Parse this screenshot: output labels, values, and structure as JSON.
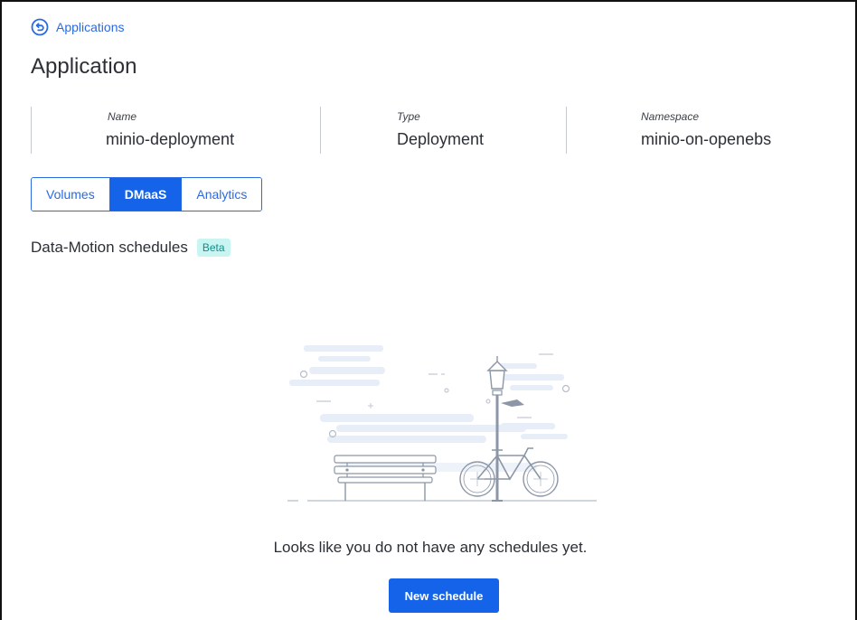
{
  "back_link": {
    "label": "Applications",
    "icon": "back-circle-icon"
  },
  "page": {
    "title": "Application"
  },
  "meta": {
    "name_label": "Name",
    "name_value": "minio-deployment",
    "type_label": "Type",
    "type_value": "Deployment",
    "namespace_label": "Namespace",
    "namespace_value": "minio-on-openebs"
  },
  "tabs": [
    {
      "label": "Volumes",
      "active": false
    },
    {
      "label": "DMaaS",
      "active": true
    },
    {
      "label": "Analytics",
      "active": false
    }
  ],
  "section": {
    "title": "Data-Motion schedules",
    "badge": "Beta"
  },
  "empty_state": {
    "message": "Looks like you do not have any schedules yet.",
    "button_label": "New schedule",
    "illustration": "park-bench-bicycle-illustration"
  },
  "colors": {
    "accent": "#1463e8",
    "link": "#2a6ae0",
    "badge_bg": "#c8f4f1",
    "badge_text": "#0f8f8a"
  }
}
